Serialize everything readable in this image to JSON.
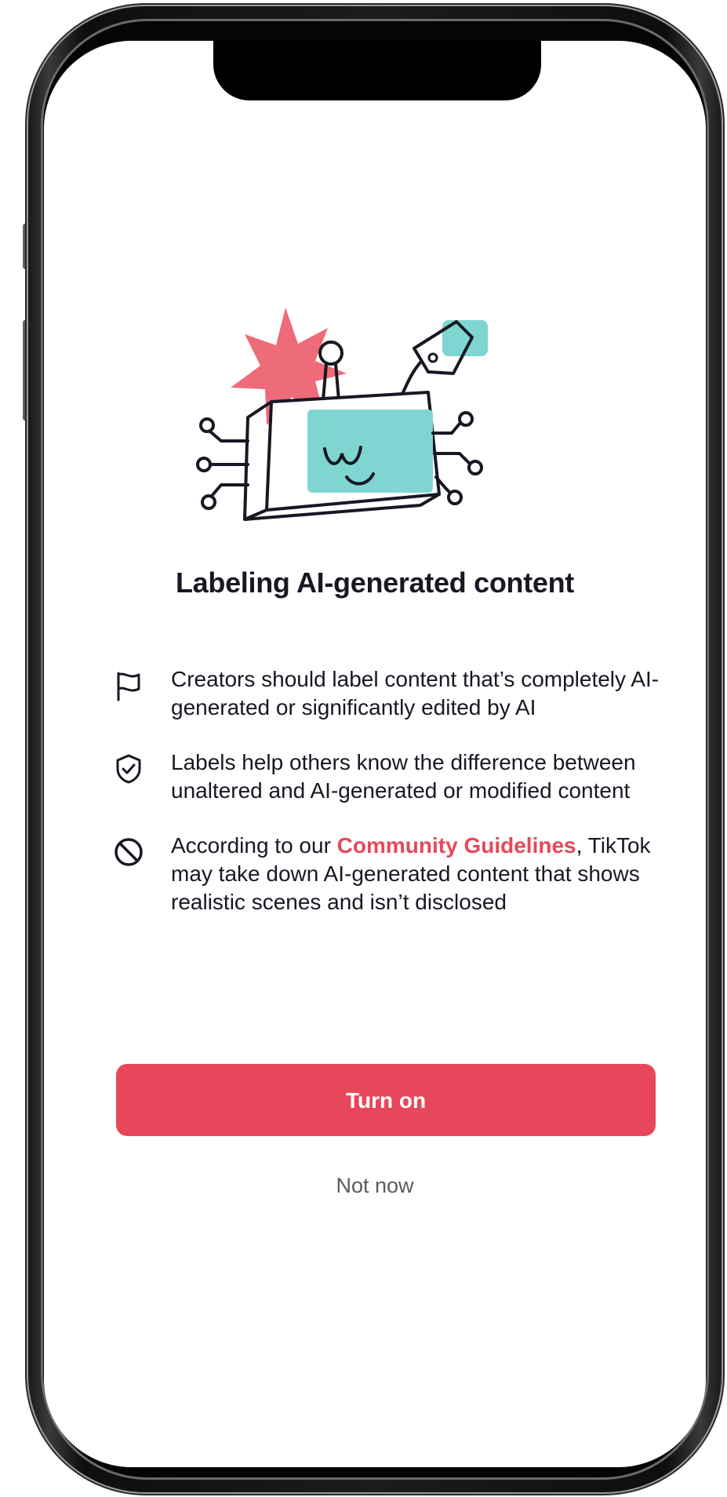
{
  "dialog": {
    "title": "Labeling AI-generated content",
    "items": [
      {
        "icon": "flag-icon",
        "text": "Creators should label content that’s completely AI-generated or significantly edited by AI"
      },
      {
        "icon": "shield-check-icon",
        "text": "Labels help others know the difference between unaltered and AI-generated or modified content"
      },
      {
        "icon": "prohibited-icon",
        "text_before": "According to our ",
        "link_text": "Community Guidelines",
        "text_after": ", TikTok may take down AI-generated content that shows realistic scenes and isn’t disclosed"
      }
    ],
    "primary_button": "Turn on",
    "secondary_button": "Not now"
  },
  "colors": {
    "accent": "#e8475b",
    "robot_face": "#7fd6d1",
    "star": "#ee6b79",
    "text": "#161823",
    "muted": "#5a5a5a"
  }
}
